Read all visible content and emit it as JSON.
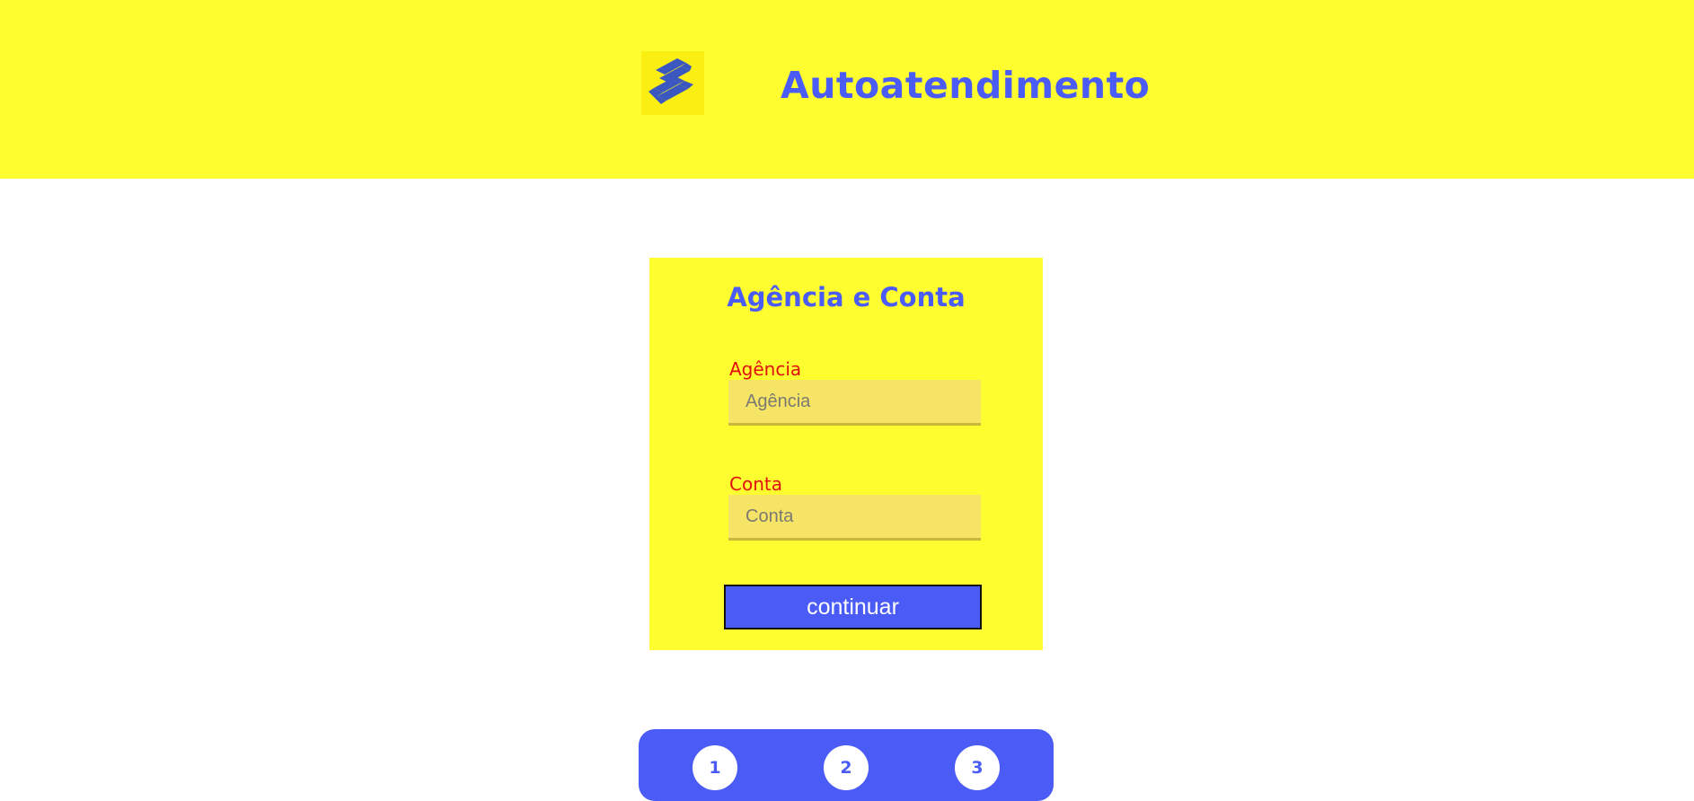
{
  "header": {
    "logo_icon": "banco-do-brasil-logo",
    "title": "Autoatendimento",
    "background_color": "#fdfd30"
  },
  "form": {
    "title": "Agência e Conta",
    "agencia": {
      "label": "Agência",
      "placeholder": "Agência",
      "value": ""
    },
    "conta": {
      "label": "Conta",
      "placeholder": "Conta",
      "value": ""
    },
    "submit_label": "continuar"
  },
  "steps": {
    "items": [
      "1",
      "2",
      "3"
    ]
  },
  "colors": {
    "accent": "#4a5cf5",
    "label": "#e01010",
    "input_background": "#f6e466",
    "panel": "#fdfd30"
  }
}
